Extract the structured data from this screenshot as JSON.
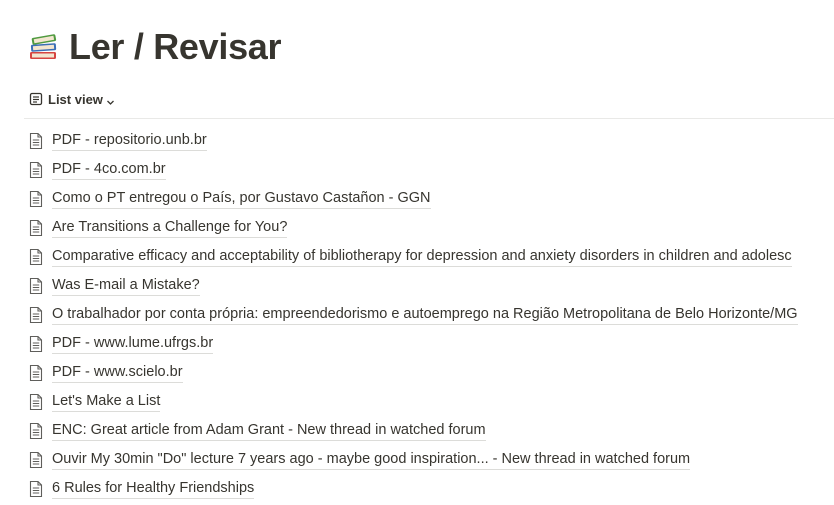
{
  "page": {
    "title": "Ler / Revisar",
    "icon": "books-emoji-icon"
  },
  "view": {
    "label": "List view",
    "icon": "list-view-icon",
    "dropdown_icon": "chevron-down-icon"
  },
  "items": [
    {
      "title": "PDF - repositorio.unb.br",
      "icon": "page-icon"
    },
    {
      "title": "PDF - 4co.com.br",
      "icon": "page-icon"
    },
    {
      "title": "Como o PT entregou o País, por Gustavo Castañon - GGN",
      "icon": "page-icon"
    },
    {
      "title": "Are Transitions a Challenge for You?",
      "icon": "page-icon"
    },
    {
      "title": "Comparative efficacy and acceptability of bibliotherapy for depression and anxiety disorders in children and adolesc",
      "icon": "page-icon"
    },
    {
      "title": "Was E-mail a Mistake?",
      "icon": "page-icon"
    },
    {
      "title": "O trabalhador por conta própria: empreendedorismo e autoemprego na Região Metropolitana de Belo Horizonte/MG",
      "icon": "page-icon"
    },
    {
      "title": "PDF - www.lume.ufrgs.br",
      "icon": "page-icon"
    },
    {
      "title": "PDF - www.scielo.br",
      "icon": "page-icon"
    },
    {
      "title": "Let's Make a List",
      "icon": "page-icon"
    },
    {
      "title": "ENC: Great article from Adam Grant - New thread in watched forum",
      "icon": "page-icon"
    },
    {
      "title": "Ouvir My 30min \"Do\" lecture 7 years ago - maybe good inspiration... - New thread in watched forum",
      "icon": "page-icon"
    },
    {
      "title": "6 Rules for Healthy Friendships",
      "icon": "page-icon"
    }
  ],
  "colors": {
    "text": "#37352f",
    "divider": "#e9e9e7",
    "underline": "#dcdcd9",
    "background": "#ffffff"
  }
}
